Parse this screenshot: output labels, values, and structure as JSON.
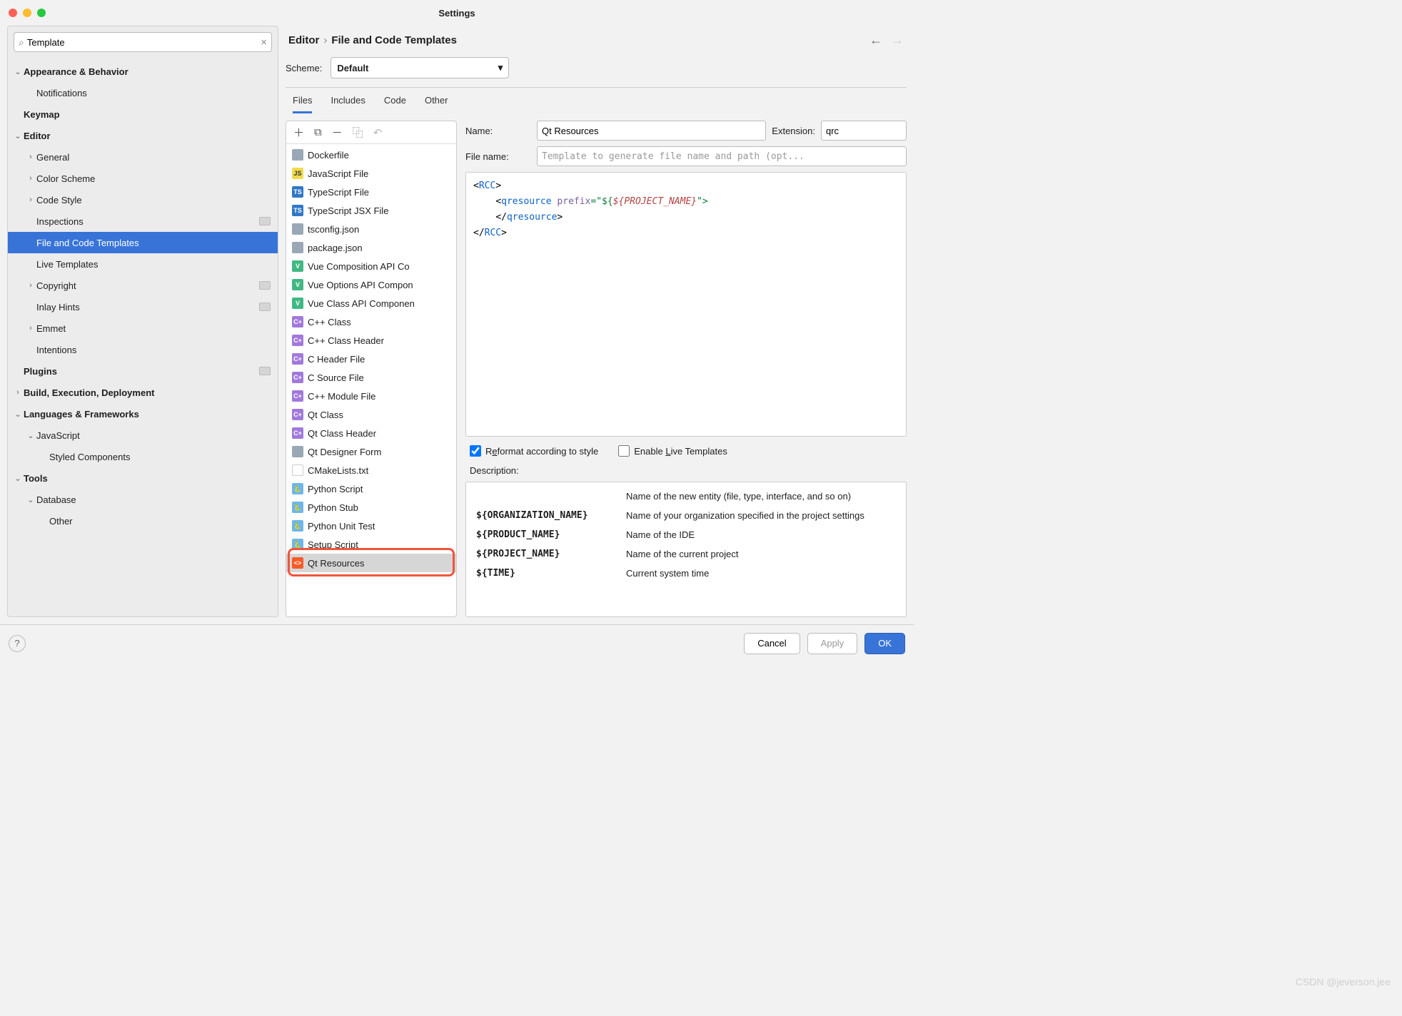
{
  "window": {
    "title": "Settings"
  },
  "search": {
    "value": "Template"
  },
  "breadcrumb": {
    "a": "Editor",
    "b": "File and Code Templates"
  },
  "scheme": {
    "label": "Scheme:",
    "value": "Default"
  },
  "tabs": [
    "Files",
    "Includes",
    "Code",
    "Other"
  ],
  "tree": [
    {
      "lv": 0,
      "label": "Appearance & Behavior",
      "bold": true,
      "arrow": "down"
    },
    {
      "lv": 1,
      "label": "Notifications"
    },
    {
      "lv": 0,
      "label": "Keymap",
      "bold": true
    },
    {
      "lv": 0,
      "label": "Editor",
      "bold": true,
      "arrow": "down"
    },
    {
      "lv": 1,
      "label": "General",
      "arrow": "right"
    },
    {
      "lv": 1,
      "label": "Color Scheme",
      "arrow": "right"
    },
    {
      "lv": 1,
      "label": "Code Style",
      "arrow": "right"
    },
    {
      "lv": 1,
      "label": "Inspections",
      "badge": true
    },
    {
      "lv": 1,
      "label": "File and Code Templates",
      "sel": true
    },
    {
      "lv": 1,
      "label": "Live Templates"
    },
    {
      "lv": 1,
      "label": "Copyright",
      "arrow": "right",
      "badge": true
    },
    {
      "lv": 1,
      "label": "Inlay Hints",
      "badge": true
    },
    {
      "lv": 1,
      "label": "Emmet",
      "arrow": "right"
    },
    {
      "lv": 1,
      "label": "Intentions"
    },
    {
      "lv": 0,
      "label": "Plugins",
      "bold": true,
      "badge": true
    },
    {
      "lv": 0,
      "label": "Build, Execution, Deployment",
      "bold": true,
      "arrow": "right"
    },
    {
      "lv": 0,
      "label": "Languages & Frameworks",
      "bold": true,
      "arrow": "down"
    },
    {
      "lv": 1,
      "label": "JavaScript",
      "arrow": "down"
    },
    {
      "lv": 2,
      "label": "Styled Components"
    },
    {
      "lv": 0,
      "label": "Tools",
      "bold": true,
      "arrow": "down"
    },
    {
      "lv": 1,
      "label": "Database",
      "arrow": "down"
    },
    {
      "lv": 2,
      "label": "Other"
    }
  ],
  "templates": [
    {
      "label": "Dockerfile",
      "icon": "file"
    },
    {
      "label": "JavaScript File",
      "icon": "js"
    },
    {
      "label": "TypeScript File",
      "icon": "ts"
    },
    {
      "label": "TypeScript JSX File",
      "icon": "ts"
    },
    {
      "label": "tsconfig.json",
      "icon": "file"
    },
    {
      "label": "package.json",
      "icon": "file"
    },
    {
      "label": "Vue Composition API Co",
      "icon": "vue"
    },
    {
      "label": "Vue Options API Compon",
      "icon": "vue"
    },
    {
      "label": "Vue Class API Componen",
      "icon": "vue"
    },
    {
      "label": "C++ Class",
      "icon": "cpp"
    },
    {
      "label": "C++ Class Header",
      "icon": "cpp"
    },
    {
      "label": "C Header File",
      "icon": "cpp"
    },
    {
      "label": "C Source File",
      "icon": "cpp"
    },
    {
      "label": "C++ Module File",
      "icon": "cpp"
    },
    {
      "label": "Qt Class",
      "icon": "cpp"
    },
    {
      "label": "Qt Class Header",
      "icon": "cpp"
    },
    {
      "label": "Qt Designer Form",
      "icon": "file"
    },
    {
      "label": "CMakeLists.txt",
      "icon": "cmk"
    },
    {
      "label": "Python Script",
      "icon": "py"
    },
    {
      "label": "Python Stub",
      "icon": "py"
    },
    {
      "label": "Python Unit Test",
      "icon": "py"
    },
    {
      "label": "Setup Script",
      "icon": "py"
    },
    {
      "label": "Qt Resources",
      "icon": "qrc",
      "sel": true,
      "hilite": true
    }
  ],
  "form": {
    "name_label": "Name:",
    "name_value": "Qt Resources",
    "ext_label": "Extension:",
    "ext_value": "qrc",
    "filename_label": "File name:",
    "filename_placeholder": "Template to generate file name and path (opt..."
  },
  "code": {
    "l1_open": "<",
    "l1_tag": "RCC",
    "l1_close": ">",
    "l2_open": "<",
    "l2_tag": "qresource",
    "l2_sp": " ",
    "l2_attr": "prefix",
    "l2_eq": "=\"",
    "l2_dlr": "${",
    "l2_var": "${PROJECT_NAME}",
    "l2_end": "\">",
    "l3_open": "</",
    "l3_tag": "qresource",
    "l3_close": ">",
    "l4_open": "</",
    "l4_tag": "RCC",
    "l4_close": ">"
  },
  "checks": {
    "reformat_pre": "R",
    "reformat_u": "e",
    "reformat_post": "format according to style",
    "live_pre": "Enable ",
    "live_u": "L",
    "live_post": "ive Templates"
  },
  "description": {
    "label": "Description:",
    "partial": "Name of the new entity (file, type, interface, and so on)",
    "rows": [
      {
        "k": "${ORGANIZATION_NAME}",
        "v": "Name of your organization specified in the project settings"
      },
      {
        "k": "${PRODUCT_NAME}",
        "v": "Name of the IDE"
      },
      {
        "k": "${PROJECT_NAME}",
        "v": "Name of the current project"
      },
      {
        "k": "${TIME}",
        "v": "Current system time"
      }
    ]
  },
  "buttons": {
    "cancel": "Cancel",
    "apply": "Apply",
    "ok": "OK"
  },
  "watermark": "CSDN @jeverson.jee"
}
